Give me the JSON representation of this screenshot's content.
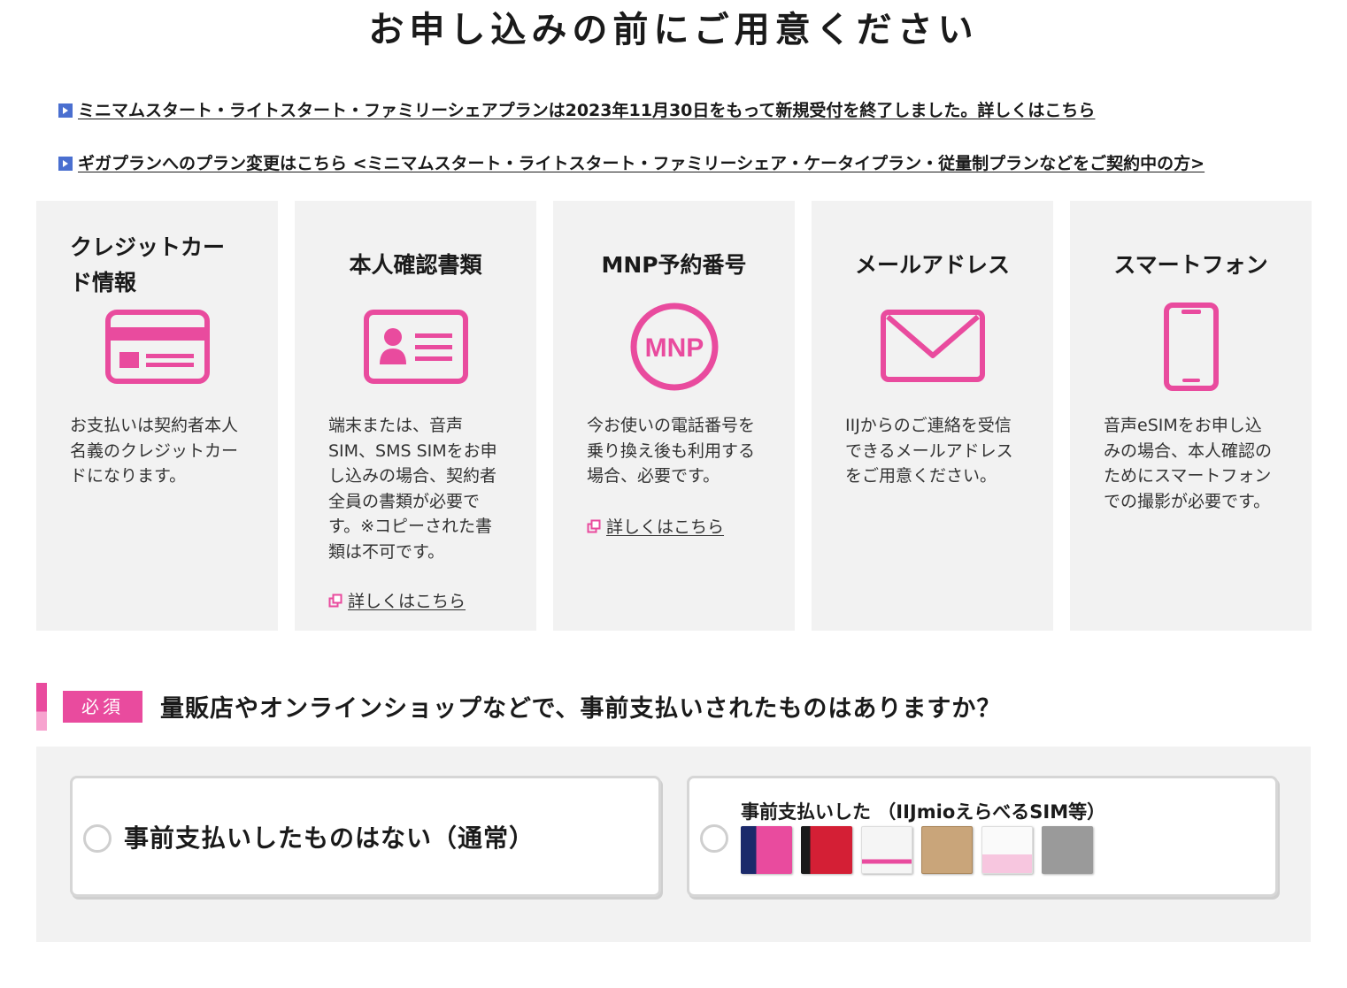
{
  "page": {
    "title": "お申し込みの前にご用意ください"
  },
  "notices": [
    {
      "text": "ミニマムスタート・ライトスタート・ファミリーシェアプランは2023年11月30日をもって新規受付を終了しました。詳しくはこちら"
    },
    {
      "text": "ギガプランへのプラン変更はこちら <ミニマムスタート・ライトスタート・ファミリーシェア・ケータイプラン・従量制プランなどをご契約中の方>"
    }
  ],
  "cards": [
    {
      "title": "クレジットカード情報",
      "icon": "credit-card-icon",
      "desc": "お支払いは契約者本人名義のクレジットカードになります。"
    },
    {
      "title": "本人確認書類",
      "icon": "id-card-icon",
      "desc": "端末または、音声SIM、SMS SIMをお申し込みの場合、契約者全員の書類が必要です。※コピーされた書類は不可です。",
      "link": "詳しくはこちら"
    },
    {
      "title": "MNP予約番号",
      "icon": "mnp-icon",
      "icon_text": "MNP",
      "desc": "今お使いの電話番号を乗り換え後も利用する場合、必要です。",
      "link": "詳しくはこちら"
    },
    {
      "title": "メールアドレス",
      "icon": "envelope-icon",
      "desc": "IIJからのご連絡を受信できるメールアドレスをご用意ください。"
    },
    {
      "title": "スマートフォン",
      "icon": "smartphone-icon",
      "desc": "音声eSIMをお申し込みの場合、本人確認のためにスマートフォンでの撮影が必要です。"
    }
  ],
  "question": {
    "badge": "必須",
    "text": "量販店やオンラインショップなどで、事前支払いされたものはありますか？",
    "options": [
      {
        "label": "事前支払いしたものはない（通常）"
      },
      {
        "label": "事前支払いした （IIJmioえらべるSIM等）"
      }
    ]
  },
  "colors": {
    "accent": "#e94b9e",
    "panel": "#f2f2f2",
    "notice_arrow": "#4a6fd0"
  }
}
